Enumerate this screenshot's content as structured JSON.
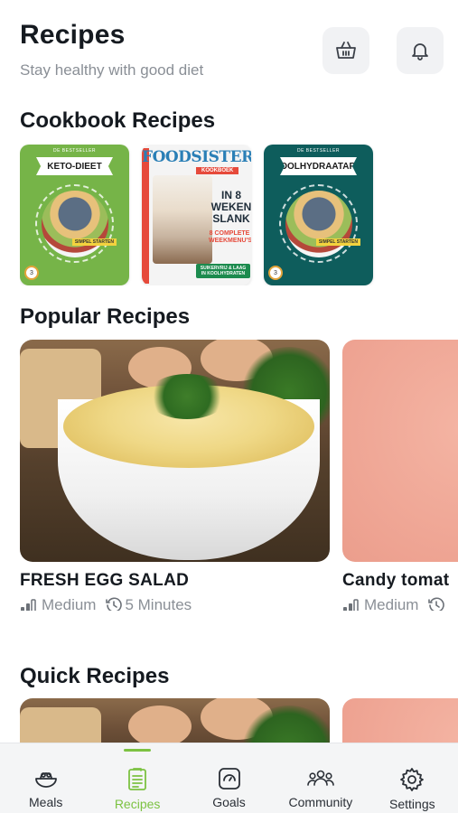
{
  "header": {
    "title": "Recipes",
    "subtitle": "Stay healthy with good diet",
    "basket_icon": "basket-icon",
    "bell_icon": "bell-icon"
  },
  "sections": {
    "cookbook": "Cookbook Recipes",
    "popular": "Popular Recipes",
    "quick": "Quick Recipes"
  },
  "cookbooks": [
    {
      "title": "KETO-DIEET",
      "color": "#76b448"
    },
    {
      "title": "FOODSISTERS",
      "subtitle": "KOOKBOEK",
      "headline": "IN 8 WEKEN SLANK",
      "color": "#f4f4f4"
    },
    {
      "title": "KOOLHYDRAATARM",
      "color": "#0e5d5c"
    }
  ],
  "popular": [
    {
      "name": "FRESH EGG SALAD",
      "difficulty": "Medium",
      "time": "5 Minutes"
    },
    {
      "name": "Candy tomat",
      "difficulty": "Medium",
      "time": ""
    }
  ],
  "tabs": [
    {
      "label": "Meals",
      "icon": "meals-icon",
      "active": false
    },
    {
      "label": "Recipes",
      "icon": "recipes-icon",
      "active": true
    },
    {
      "label": "Goals",
      "icon": "goals-icon",
      "active": false
    },
    {
      "label": "Community",
      "icon": "community-icon",
      "active": false
    },
    {
      "label": "Settings",
      "icon": "settings-icon",
      "active": false
    }
  ],
  "colors": {
    "accent": "#7cc242",
    "text": "#151a20",
    "muted": "#8a8f96"
  }
}
